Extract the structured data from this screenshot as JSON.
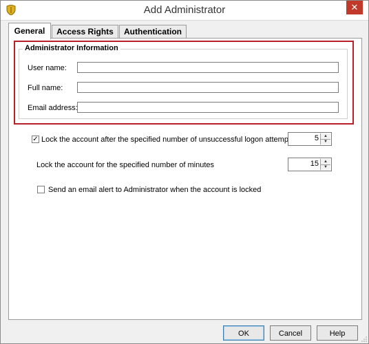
{
  "window": {
    "title": "Add Administrator",
    "close_glyph": "✕"
  },
  "tabs": [
    {
      "label": "General",
      "active": true
    },
    {
      "label": "Access Rights",
      "active": false
    },
    {
      "label": "Authentication",
      "active": false
    }
  ],
  "admin_info": {
    "group_title": "Administrator Information",
    "user_name_label": "User name:",
    "user_name_value": "",
    "full_name_label": "Full name:",
    "full_name_value": "",
    "email_label": "Email address:",
    "email_value": ""
  },
  "lockout": {
    "attempts_label": "Lock the account after the specified number of unsuccessful logon attempts",
    "attempts_checked": true,
    "attempts_value": "5",
    "minutes_label": "Lock the account for the specified number of minutes",
    "minutes_value": "15",
    "alert_label": "Send an email alert to Administrator when the account is locked",
    "alert_checked": false
  },
  "buttons": {
    "ok": "OK",
    "cancel": "Cancel",
    "help": "Help"
  },
  "colors": {
    "highlight": "#b82027",
    "close": "#c0392b"
  }
}
